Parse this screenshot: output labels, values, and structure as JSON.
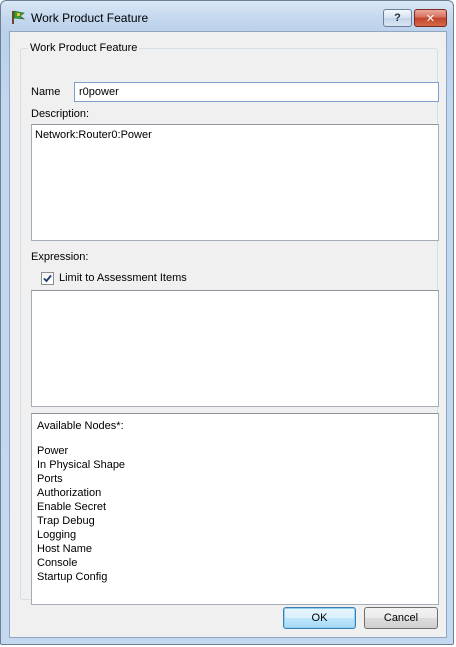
{
  "window": {
    "title": "Work Product Feature",
    "help_label": "?",
    "close_label": "✕"
  },
  "group": {
    "legend": "Work Product Feature"
  },
  "name": {
    "label": "Name",
    "value": "r0power"
  },
  "description": {
    "label": "Description:",
    "value": "Network:Router0:Power"
  },
  "expression": {
    "label": "Expression:",
    "value": ""
  },
  "limit_checkbox": {
    "label": "Limit to Assessment Items",
    "checked": true
  },
  "nodes": {
    "heading": "Available Nodes*:",
    "items": [
      "Power",
      "In Physical Shape",
      "Ports",
      "Authorization",
      "Enable Secret",
      "Trap Debug",
      "Logging",
      "Host Name",
      "Console",
      "Startup Config"
    ]
  },
  "buttons": {
    "ok": "OK",
    "cancel": "Cancel"
  },
  "icons": {
    "app": "flag-icon",
    "check": "checkmark-icon"
  }
}
